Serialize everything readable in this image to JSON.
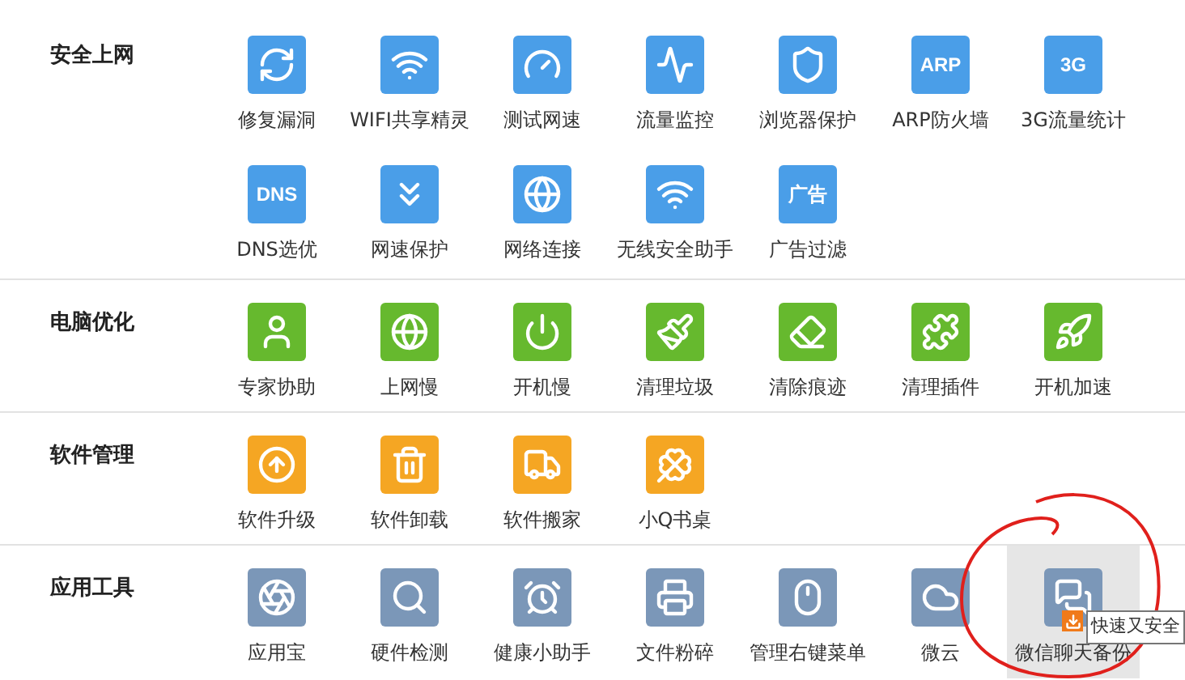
{
  "sections": [
    {
      "title": "安全上网",
      "color": "#4a9ee8",
      "items": [
        {
          "label": "修复漏洞",
          "selected": false
        },
        {
          "label": "WIFI共享精灵",
          "selected": false
        },
        {
          "label": "测试网速",
          "selected": false
        },
        {
          "label": "流量监控",
          "selected": false
        },
        {
          "label": "浏览器保护",
          "selected": false
        },
        {
          "label": "ARP防火墙",
          "icon_text": "ARP",
          "selected": false
        },
        {
          "label": "3G流量统计",
          "icon_text": "3G",
          "selected": false
        },
        {
          "label": "DNS选优",
          "icon_text": "DNS",
          "selected": false
        },
        {
          "label": "网速保护",
          "selected": false
        },
        {
          "label": "网络连接",
          "selected": false
        },
        {
          "label": "无线安全助手",
          "selected": false
        },
        {
          "label": "广告过滤",
          "icon_text": "广告",
          "selected": false
        }
      ]
    },
    {
      "title": "电脑优化",
      "color": "#66b92e",
      "items": [
        {
          "label": "专家协助",
          "selected": false
        },
        {
          "label": "上网慢",
          "selected": false
        },
        {
          "label": "开机慢",
          "selected": false
        },
        {
          "label": "清理垃圾",
          "selected": false
        },
        {
          "label": "清除痕迹",
          "selected": false
        },
        {
          "label": "清理插件",
          "selected": false
        },
        {
          "label": "开机加速",
          "selected": false
        }
      ]
    },
    {
      "title": "软件管理",
      "color": "#f5a623",
      "items": [
        {
          "label": "软件升级",
          "selected": false
        },
        {
          "label": "软件卸载",
          "selected": false
        },
        {
          "label": "软件搬家",
          "selected": false
        },
        {
          "label": "小Q书桌",
          "selected": false
        }
      ]
    },
    {
      "title": "应用工具",
      "color": "#7b97b8",
      "items": [
        {
          "label": "应用宝",
          "selected": false
        },
        {
          "label": "硬件检测",
          "selected": false
        },
        {
          "label": "健康小助手",
          "selected": false
        },
        {
          "label": "文件粉碎",
          "selected": false
        },
        {
          "label": "管理右键菜单",
          "selected": false
        },
        {
          "label": "微云",
          "selected": false
        },
        {
          "label": "微信聊天备份",
          "selected": true,
          "download_badge": true
        }
      ]
    }
  ],
  "tooltip": {
    "text": "快速又安全"
  }
}
